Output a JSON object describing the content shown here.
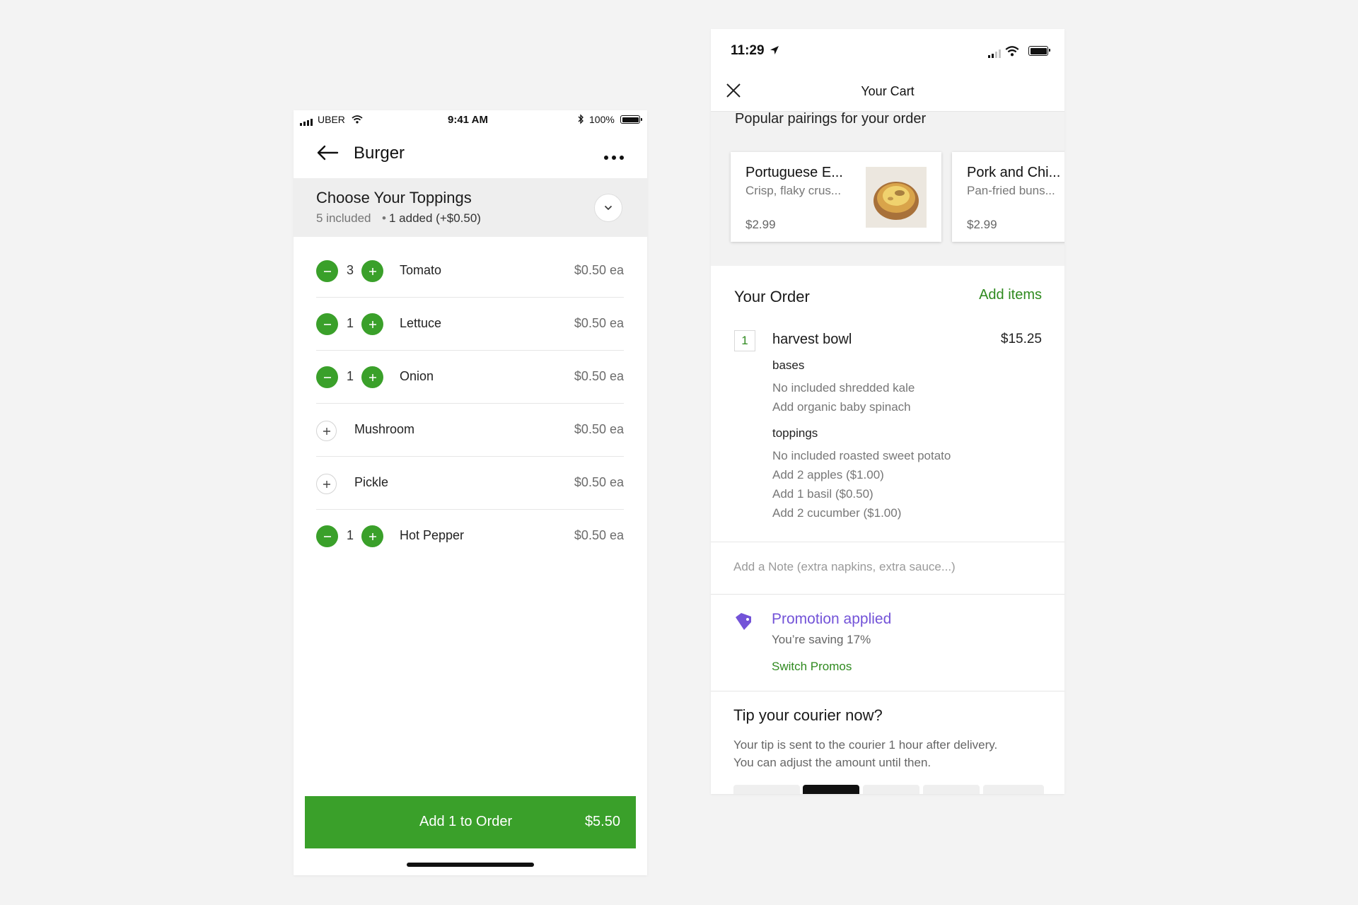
{
  "left": {
    "status_bar": {
      "carrier": "UBER",
      "time": "9:41 AM",
      "battery": "100%"
    },
    "header": {
      "title": "Burger"
    },
    "section": {
      "title": "Choose Your Toppings",
      "included": "5 included",
      "added": "1 added (+$0.50)"
    },
    "toppings": [
      {
        "name": "Tomato",
        "qty": "3",
        "price": "$0.50 ea"
      },
      {
        "name": "Lettuce",
        "qty": "1",
        "price": "$0.50 ea"
      },
      {
        "name": "Onion",
        "qty": "1",
        "price": "$0.50 ea"
      },
      {
        "name": "Mushroom",
        "qty": "",
        "price": "$0.50 ea"
      },
      {
        "name": "Pickle",
        "qty": "",
        "price": "$0.50 ea"
      },
      {
        "name": "Hot Pepper",
        "qty": "1",
        "price": "$0.50 ea"
      }
    ],
    "add_button": {
      "label": "Add 1 to Order",
      "price": "$5.50"
    }
  },
  "right": {
    "status_bar": {
      "time": "11:29"
    },
    "header": {
      "title": "Your Cart"
    },
    "pairings": {
      "title": "Popular pairings for your order",
      "items": [
        {
          "name": "Portuguese E...",
          "desc": "Crisp, flaky crus...",
          "price": "$2.99"
        },
        {
          "name": "Pork and Chi...",
          "desc": "Pan-fried buns...",
          "price": "$2.99"
        }
      ]
    },
    "order": {
      "title": "Your Order",
      "add_items": "Add items",
      "item": {
        "qty": "1",
        "name": "harvest bowl",
        "price": "$15.25",
        "groups": [
          {
            "label": "bases",
            "lines": [
              "No included shredded kale",
              "Add organic baby spinach"
            ]
          },
          {
            "label": "toppings",
            "lines": [
              "No included roasted sweet potato",
              "Add 2 apples ($1.00)",
              "Add 1 basil ($0.50)",
              "Add 2 cucumber ($1.00)"
            ]
          }
        ]
      }
    },
    "note": {
      "placeholder": "Add a Note (extra napkins, extra sauce...)"
    },
    "promo": {
      "title": "Promotion applied",
      "subtitle": "You’re saving 17%",
      "switch": "Switch Promos"
    },
    "tip": {
      "title": "Tip your courier now?",
      "line1": "Your tip is sent to the courier 1 hour after delivery.",
      "line2": "You can adjust the amount until then."
    }
  },
  "colors": {
    "green": "#3aa02a",
    "green_text": "#2f8a1f",
    "purple": "#7353d8",
    "background": "#f3f3f3"
  }
}
